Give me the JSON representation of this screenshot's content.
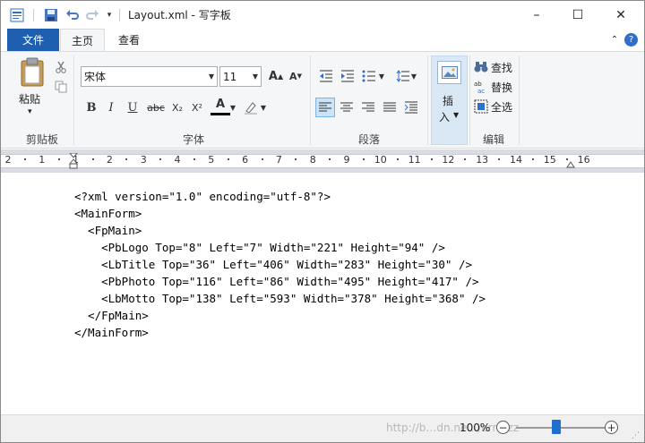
{
  "window": {
    "title": "Layout.xml - 写字板",
    "minimize": "–",
    "maximize": "☐",
    "close": "✕"
  },
  "quick_access": {
    "app_icon": "wordpad-app-icon",
    "save_icon": "save-icon",
    "undo_icon": "undo-icon",
    "redo_icon": "redo-icon",
    "customize_icon": "dropdown-icon"
  },
  "tabs": {
    "file": "文件",
    "home": "主页",
    "view": "查看"
  },
  "ribbon": {
    "clipboard": {
      "paste": "粘贴",
      "paste_sub": "▾",
      "group": "剪贴板"
    },
    "font": {
      "name": "宋体",
      "size": "11",
      "group": "字体",
      "bold": "B",
      "italic": "I",
      "underline": "U",
      "strike": "abc",
      "subscript": "X₂",
      "superscript": "X²",
      "color": "A"
    },
    "paragraph": {
      "group": "段落"
    },
    "insert": {
      "label_line1": "插",
      "label_line2": "入"
    },
    "editing": {
      "find": "查找",
      "replace": "替换",
      "select_all": "全选",
      "group": "编辑"
    }
  },
  "ruler": {
    "numbers": [
      "2",
      "1",
      "1",
      "2",
      "3",
      "4",
      "5",
      "6",
      "7",
      "8",
      "9",
      "10",
      "11",
      "12",
      "13",
      "14",
      "15",
      "16"
    ]
  },
  "document": {
    "lines": [
      "<?xml version=\"1.0\" encoding=\"utf-8\"?>",
      "<MainForm>",
      "  <FpMain>",
      "    <PbLogo Top=\"8\" Left=\"7\" Width=\"221\" Height=\"94\" />",
      "    <LbTitle Top=\"36\" Left=\"406\" Width=\"283\" Height=\"30\" />",
      "    <PbPhoto Top=\"116\" Left=\"86\" Width=\"495\" Height=\"417\" />",
      "    <LbMotto Top=\"138\" Left=\"593\" Width=\"378\" Height=\"368\" />",
      "  </FpMain>",
      "</MainForm>"
    ]
  },
  "status": {
    "zoom": "100%",
    "zoom_out": "−",
    "zoom_in": "+",
    "watermark": "http://b…dn.ne…/arr…zz"
  }
}
